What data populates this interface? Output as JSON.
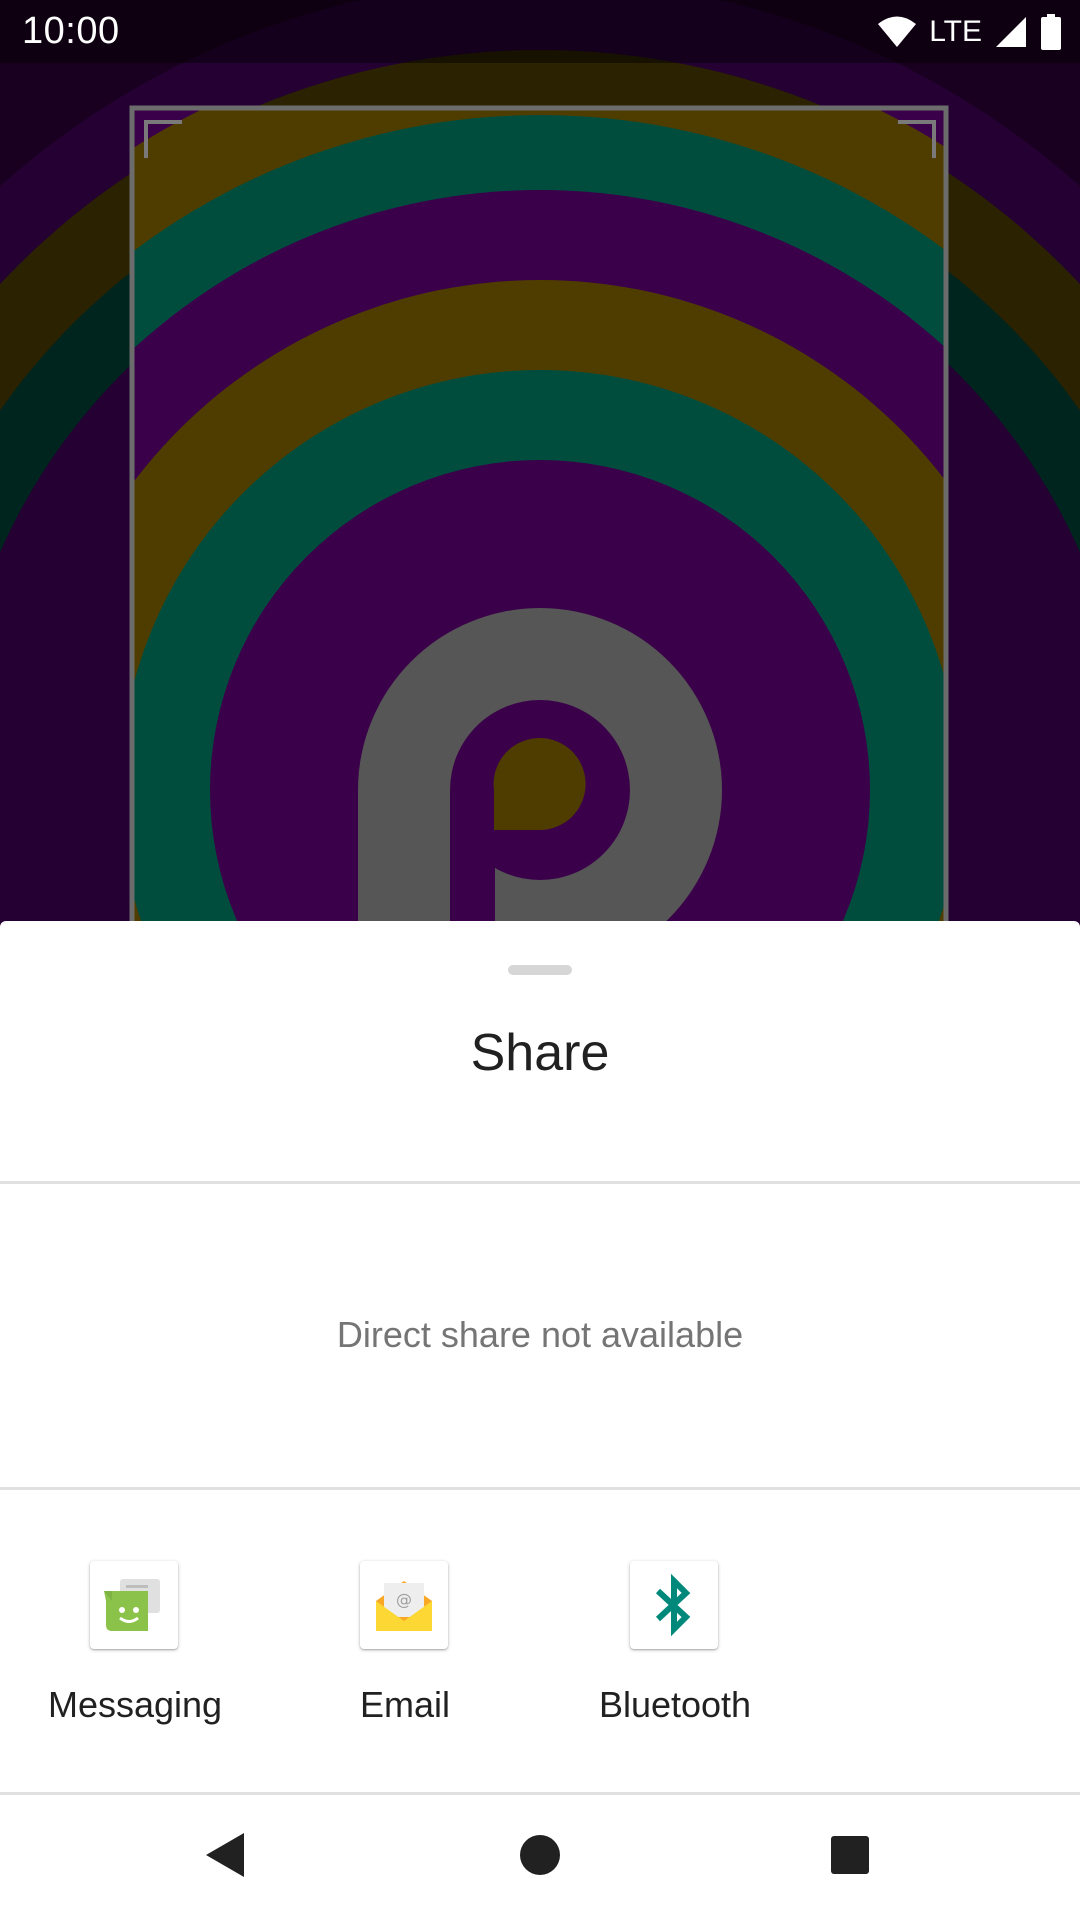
{
  "status_bar": {
    "time": "10:00",
    "network": "LTE",
    "icons": [
      "wifi-icon",
      "cell-signal-icon",
      "battery-icon"
    ]
  },
  "wallpaper": {
    "colors": {
      "purple": "#3b004a",
      "teal": "#004d3e",
      "gold": "#4f3d00",
      "gray": "#565656"
    }
  },
  "share_sheet": {
    "title": "Share",
    "direct_share_message": "Direct share not available",
    "targets": [
      {
        "label": "Messaging",
        "icon": "messaging-icon"
      },
      {
        "label": "Email",
        "icon": "email-icon"
      },
      {
        "label": "Bluetooth",
        "icon": "bluetooth-icon"
      }
    ]
  },
  "nav_bar": {
    "buttons": [
      "back-icon",
      "home-icon",
      "recents-icon"
    ]
  }
}
